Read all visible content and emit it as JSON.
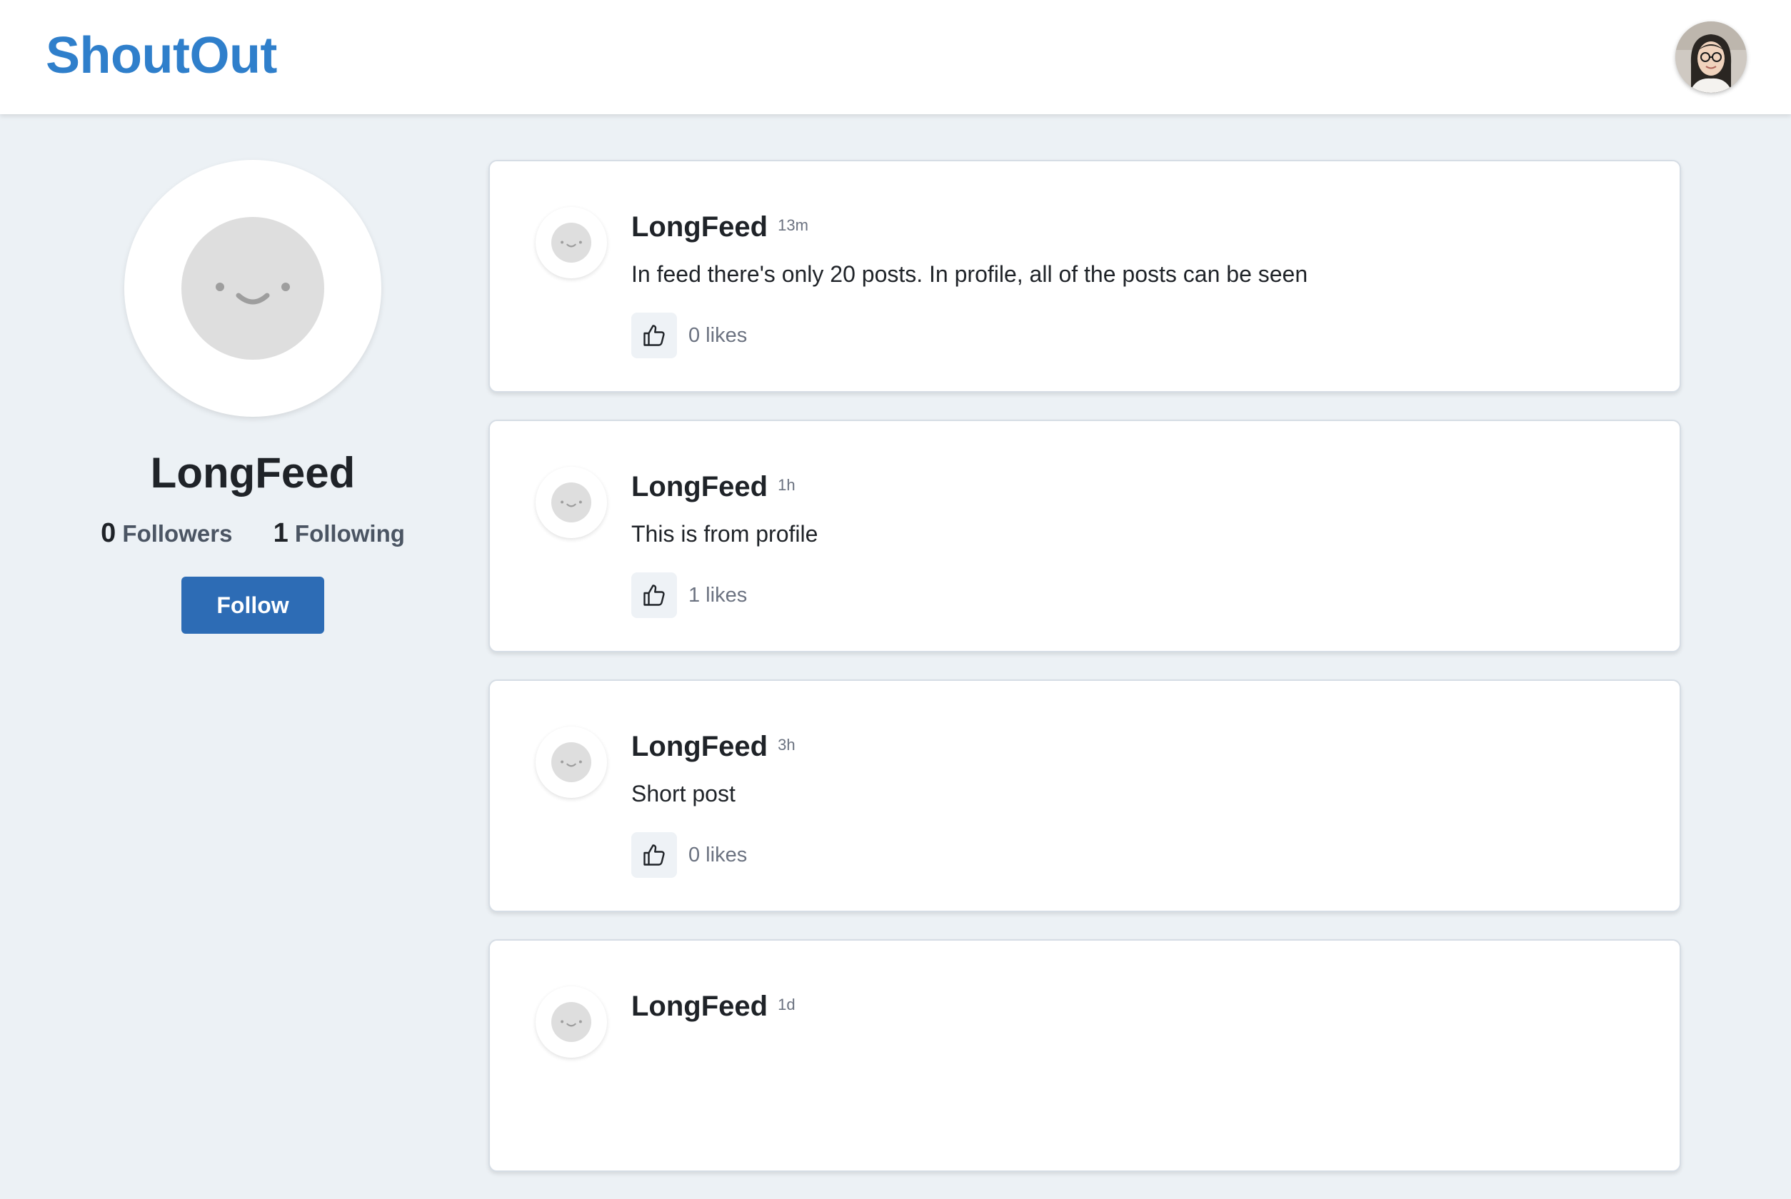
{
  "app": {
    "brand": "ShoutOut",
    "user_avatar_icon": "user-photo-avatar"
  },
  "profile": {
    "name": "LongFeed",
    "followers_count": "0",
    "followers_label": "Followers",
    "following_count": "1",
    "following_label": "Following",
    "follow_label": "Follow",
    "avatar_icon": "smiley-placeholder-avatar"
  },
  "colors": {
    "brand": "#2f7fcb",
    "follow_button": "#2d6cb5",
    "background": "#ecf1f5"
  },
  "posts": [
    {
      "author": "LongFeed",
      "time": "13m",
      "text": "In feed there's only 20 posts. In profile, all of the posts can be seen",
      "likes": "0 likes"
    },
    {
      "author": "LongFeed",
      "time": "1h",
      "text": "This is from profile",
      "likes": "1 likes"
    },
    {
      "author": "LongFeed",
      "time": "3h",
      "text": "Short post",
      "likes": "0 likes"
    },
    {
      "author": "LongFeed",
      "time": "1d",
      "text": "",
      "likes": ""
    }
  ]
}
